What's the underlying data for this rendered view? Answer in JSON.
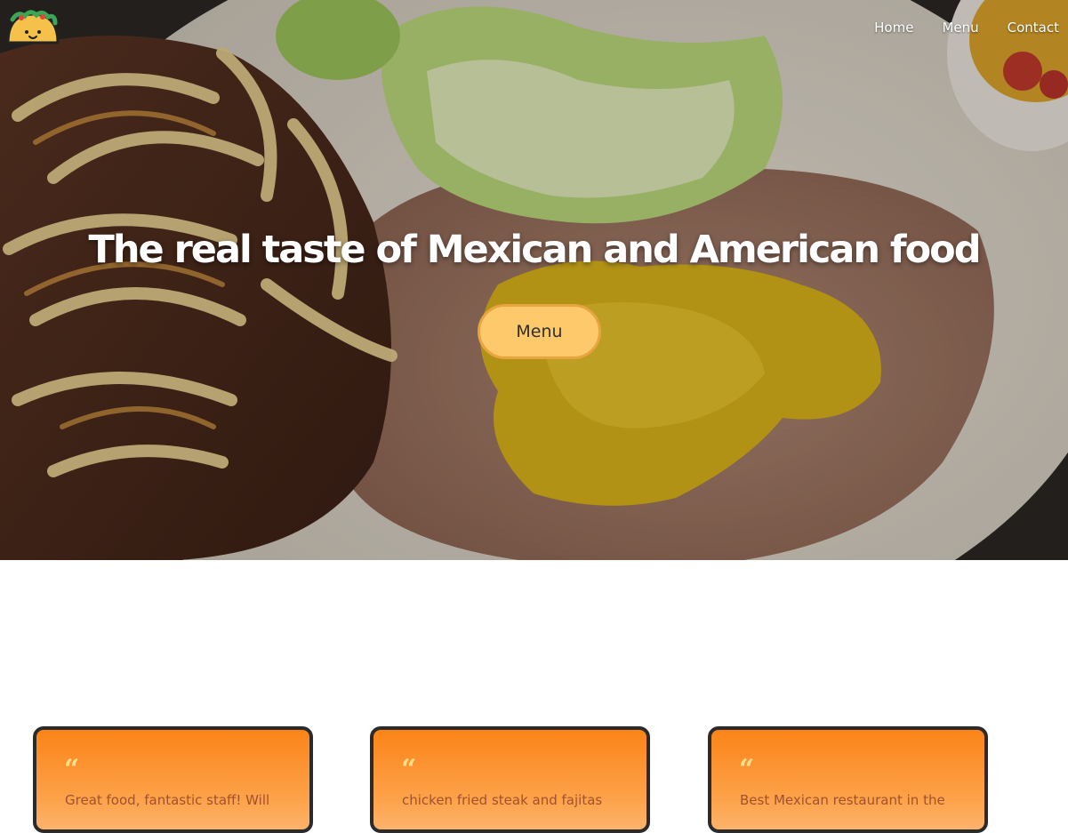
{
  "brand": {
    "logo_icon": "taco-logo-icon"
  },
  "nav": {
    "items": [
      {
        "label": "Home"
      },
      {
        "label": "Menu"
      },
      {
        "label": "Contact"
      }
    ]
  },
  "hero": {
    "title": "The real taste of Mexican and American food",
    "button_label": "Menu"
  },
  "reviews": [
    {
      "quote_icon": "quote-icon",
      "quote_mark": "“",
      "text": "Great food, fantastic staff! Will"
    },
    {
      "quote_icon": "quote-icon",
      "quote_mark": "“",
      "text": "chicken fried steak and fajitas"
    },
    {
      "quote_icon": "quote-icon",
      "quote_mark": "“",
      "text": "Best Mexican restaurant in the"
    }
  ],
  "colors": {
    "accent": "#fdc96a",
    "accent_border": "#e8a43f",
    "card_top": "#fb8418",
    "card_bottom": "#fdb36b",
    "card_border": "#2b2b2b"
  }
}
